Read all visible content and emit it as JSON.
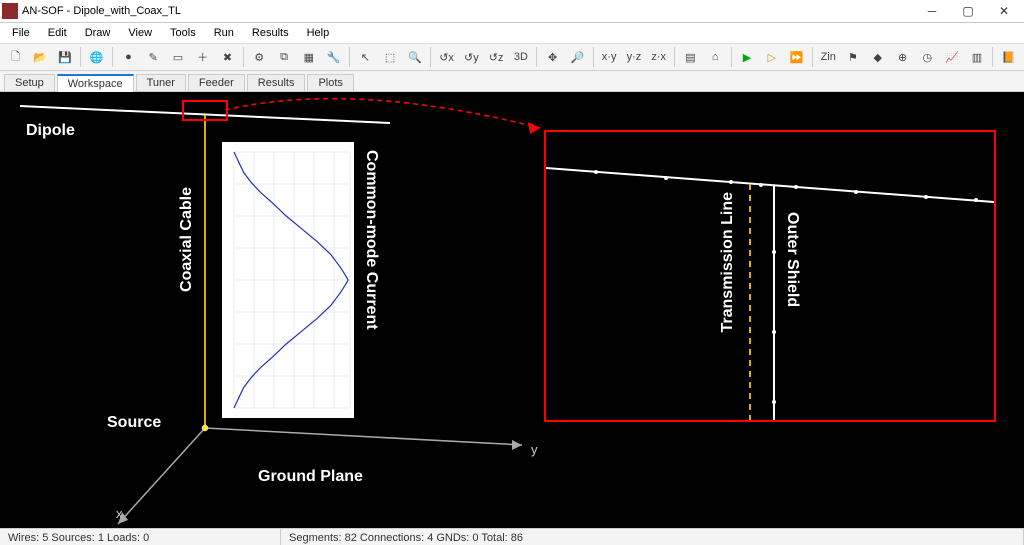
{
  "window": {
    "title": "AN-SOF - Dipole_with_Coax_TL"
  },
  "menu": [
    "File",
    "Edit",
    "Draw",
    "View",
    "Tools",
    "Run",
    "Results",
    "Help"
  ],
  "tabs": [
    "Setup",
    "Workspace",
    "Tuner",
    "Feeder",
    "Results",
    "Plots"
  ],
  "active_tab": 1,
  "labels": {
    "dipole": "Dipole",
    "coax": "Coaxial Cable",
    "common": "Common-mode Current",
    "source": "Source",
    "ground": "Ground Plane",
    "tline": "Transmission Line",
    "shield": "Outer Shield",
    "x": "x",
    "y": "y"
  },
  "status": {
    "left": "Wires: 5  Sources: 1  Loads: 0",
    "mid": "Segments: 82  Connections: 4  GNDs: 0  Total: 86"
  },
  "toolbar_icons": [
    "new",
    "open",
    "save",
    "sep",
    "globe",
    "sep",
    "circle",
    "pencil",
    "square",
    "plus",
    "x",
    "sep",
    "gear",
    "overlap",
    "grid",
    "wrench",
    "sep",
    "cursor",
    "select",
    "zoom",
    "sep",
    "rot-x",
    "rot-y",
    "rot-z",
    "3d",
    "sep",
    "move",
    "magnify",
    "sep",
    "xy",
    "yz",
    "zx",
    "sep",
    "panel",
    "home",
    "sep",
    "play",
    "step",
    "fwd",
    "sep",
    "Z",
    "flag",
    "diamond",
    "earth",
    "clock",
    "chart",
    "sheet",
    "sep",
    "book"
  ],
  "chart_data": {
    "type": "line",
    "title": "",
    "xlabel": "",
    "ylabel": "",
    "xlim": [
      0,
      1.2
    ],
    "ylim": [
      0,
      100
    ],
    "x": [
      0.0,
      0.05,
      0.1,
      0.18,
      0.28,
      0.4,
      0.54,
      0.7,
      0.86,
      1.0,
      1.1,
      1.15,
      1.18,
      1.15,
      1.1,
      1.0,
      0.86,
      0.7,
      0.54,
      0.4,
      0.28,
      0.18,
      0.1,
      0.05,
      0.0
    ],
    "y": [
      0,
      4,
      8,
      12,
      16,
      20,
      25,
      30,
      35,
      40,
      45,
      48,
      50,
      52,
      55,
      60,
      65,
      70,
      75,
      80,
      84,
      88,
      92,
      96,
      100
    ]
  },
  "colors": {
    "accent_red": "#ff0000",
    "wire": "#ffffff",
    "coax": "#e0b000",
    "bg": "#000000"
  }
}
